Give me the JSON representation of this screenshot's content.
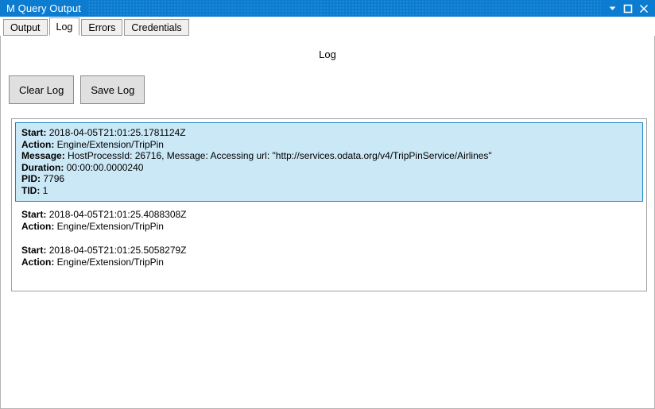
{
  "window": {
    "title": "M Query Output",
    "controls": [
      {
        "name": "minimize-button",
        "icon": "chevron-down-icon",
        "label": "Minimize"
      },
      {
        "name": "maximize-button",
        "icon": "square-icon",
        "label": "Maximize"
      },
      {
        "name": "close-button",
        "icon": "close-icon",
        "label": "Close"
      }
    ]
  },
  "tabs": [
    {
      "label": "Output",
      "active": false
    },
    {
      "label": "Log",
      "active": true
    },
    {
      "label": "Errors",
      "active": false
    },
    {
      "label": "Credentials",
      "active": false
    }
  ],
  "heading": "Log",
  "buttons": {
    "clear_log": "Clear Log",
    "save_log": "Save Log"
  },
  "labels": {
    "start": "Start:",
    "action": "Action:",
    "message": "Message:",
    "duration": "Duration:",
    "pid": "PID:",
    "tid": "TID:"
  },
  "log_entries": [
    {
      "selected": true,
      "start": "2018-04-05T21:01:25.1781124Z",
      "action": "Engine/Extension/TripPin",
      "message": "HostProcessId: 26716, Message: Accessing url: \"http://services.odata.org/v4/TripPinService/Airlines\"",
      "duration": "00:00:00.0000240",
      "pid": "7796",
      "tid": "1"
    },
    {
      "selected": false,
      "start": "2018-04-05T21:01:25.4088308Z",
      "action": "Engine/Extension/TripPin"
    },
    {
      "selected": false,
      "start": "2018-04-05T21:01:25.5058279Z",
      "action": "Engine/Extension/TripPin"
    }
  ],
  "colors": {
    "titlebar": "#0c7cd0",
    "selection_fill": "#cbe8f6",
    "selection_border": "#1a8ac6",
    "button_face": "#e0e0e0"
  }
}
